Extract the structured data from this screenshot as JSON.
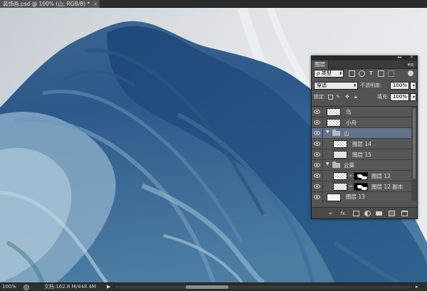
{
  "document": {
    "tab_title": "装饰画.psd @ 100% (山, RGB/8) *",
    "tab_close": "×"
  },
  "status_bar": {
    "zoom": "100%",
    "doc_info": "文档:162.8 M/448.4M",
    "arrow": "▶"
  },
  "layers_panel": {
    "collapse_glyph": "◂◂",
    "close_glyph": "✕",
    "tab_label": "图层",
    "menu_glyph": "▾≡",
    "filter": {
      "value": "ρ 类型",
      "icons": [
        "image-filter-icon",
        "adjustment-filter-icon",
        "type-filter-icon",
        "shape-filter-icon",
        "smart-object-filter-icon"
      ]
    },
    "blend_mode": "穿透",
    "opacity_label": "不透明度:",
    "opacity_value": "100%",
    "lock_label": "锁定:",
    "fill_label": "填充:",
    "fill_value": "100%",
    "layers": [
      {
        "name": "鸟",
        "type": "layer",
        "thumb": "transparent",
        "indent": 0
      },
      {
        "name": "小舟",
        "type": "layer",
        "thumb": "transparent",
        "indent": 0
      },
      {
        "name": "山",
        "type": "group",
        "selected": true,
        "indent": 0
      },
      {
        "name": "图层 14",
        "type": "layer",
        "thumb": "transparent",
        "indent": 1
      },
      {
        "name": "图层 15",
        "type": "layer",
        "thumb": "transparent",
        "indent": 1
      },
      {
        "name": "云雾",
        "type": "group",
        "indent": 0
      },
      {
        "name": "图层 12",
        "type": "layer",
        "thumb": "transparent",
        "mask": true,
        "indent": 1
      },
      {
        "name": "图层 12 副本",
        "type": "layer",
        "thumb": "transparent",
        "mask": true,
        "indent": 1
      },
      {
        "name": "图层 13",
        "type": "layer",
        "thumb": "white",
        "indent": 0
      }
    ],
    "footer_icons": [
      "link-layers-icon",
      "fx-icon",
      "add-mask-icon",
      "adjustment-layer-icon",
      "new-group-icon",
      "new-layer-icon",
      "delete-layer-icon"
    ],
    "footer_fx": "fx."
  },
  "colors": {
    "panel_bg": "#535353",
    "selected_layer": "#62728a",
    "mountain_dark": "#1f4a7a",
    "mountain_light": "#8fb3cf"
  }
}
